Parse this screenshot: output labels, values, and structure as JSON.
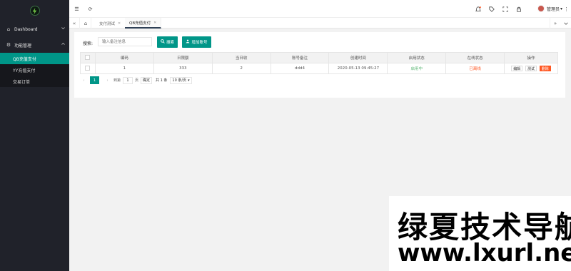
{
  "sidebar": {
    "dashboard_label": "Dashboard",
    "func_mgmt_label": "功能管理",
    "items": [
      {
        "label": "QB充值支付"
      },
      {
        "label": "YY充值支付"
      },
      {
        "label": "交易订单"
      }
    ]
  },
  "header": {
    "admin_label": "管理员"
  },
  "tabs": [
    {
      "label": "支付测试"
    },
    {
      "label": "QB充值支付"
    }
  ],
  "search": {
    "label": "搜索:",
    "placeholder": "输入备注信息",
    "search_button": "搜索",
    "add_button": "增加账号"
  },
  "table": {
    "columns": [
      "编码",
      "日限额",
      "当日收",
      "账号备注",
      "创建时间",
      "启用状态",
      "在线状态",
      "操作"
    ],
    "rows": [
      {
        "id": "1",
        "limit": "333",
        "today": "2",
        "note": "ddd4",
        "created": "2020-05-13 09:45:27",
        "enabled": "启用中",
        "online": "已离线",
        "edit": "编辑",
        "test": "测试",
        "delete": "删除"
      }
    ]
  },
  "pager": {
    "current": "1",
    "goto_label": "到第",
    "goto_value": "1",
    "page_unit": "页",
    "confirm": "确定",
    "total": "共 1 条",
    "page_size": "10 条/页"
  },
  "watermark": {
    "line1": "绿夏技术导航",
    "line2": "www.lxurl.net"
  },
  "colors": {
    "accent": "#009688",
    "sidebar_bg": "#20222a",
    "enabled": "#5fb878",
    "offline": "#ff5722"
  }
}
